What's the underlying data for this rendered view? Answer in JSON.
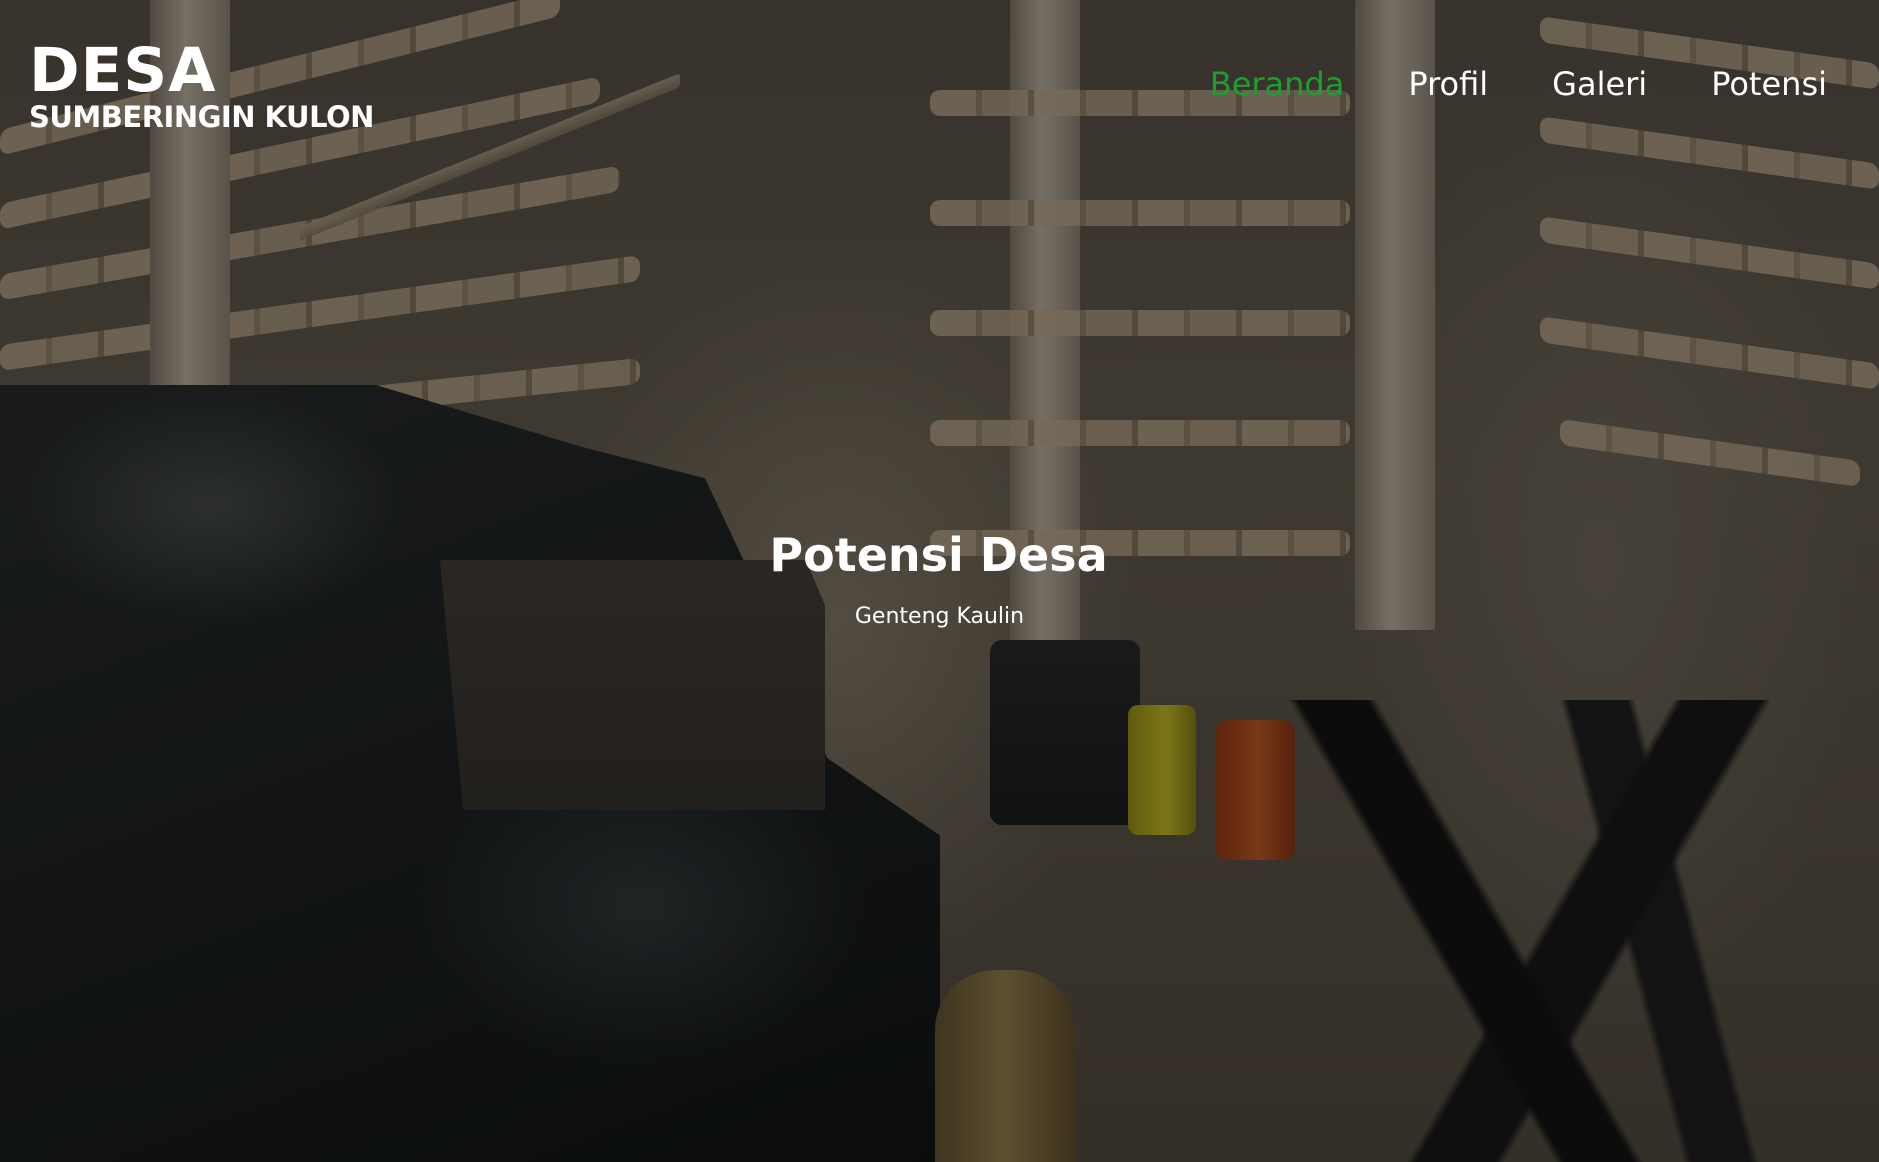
{
  "brand": {
    "title": "DESA",
    "subtitle": "SUMBERINGIN KULON"
  },
  "nav": {
    "items": [
      {
        "label": "Beranda",
        "active": true
      },
      {
        "label": "Profil",
        "active": false
      },
      {
        "label": "Galeri",
        "active": false
      },
      {
        "label": "Potensi",
        "active": false
      }
    ],
    "active_color": "#1e9e2f"
  },
  "hero": {
    "title": "Potensi Desa",
    "subtitle": "Genteng Kaulin"
  }
}
